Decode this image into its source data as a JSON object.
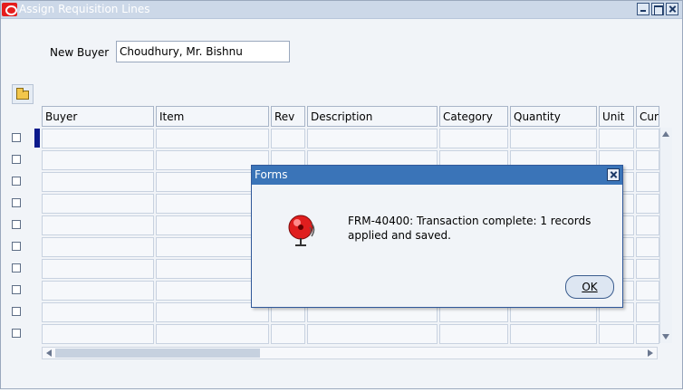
{
  "window": {
    "title": "Assign Requisition Lines",
    "controls": [
      "minimize",
      "maximize",
      "close"
    ]
  },
  "form": {
    "new_buyer_label": "New Buyer",
    "new_buyer_value": "Choudhury, Mr. Bishnu"
  },
  "grid": {
    "columns": [
      "Buyer",
      "Item",
      "Rev",
      "Description",
      "Category",
      "Quantity",
      "Unit",
      "Cur"
    ],
    "row_count": 10
  },
  "dialog": {
    "title": "Forms",
    "message": "FRM-40400: Transaction complete: 1 records applied and saved.",
    "ok_label": "OK",
    "icon": "alarm-bell-icon"
  },
  "colors": {
    "titlebar": "#ccd8e8",
    "dialog_titlebar": "#3a74b8",
    "row_marker": "#0c1a8c"
  }
}
